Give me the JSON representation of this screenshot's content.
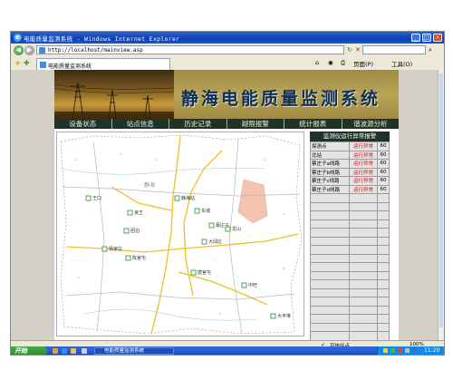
{
  "window": {
    "title": "电能质量监测系统 - Windows Internet Explorer"
  },
  "browser": {
    "address": "http://localhost/mainview.asp",
    "search_placeholder": "",
    "tab_title": "电能质量监测系统",
    "page_menu": "页面(P)",
    "tools_menu": "工具(O)"
  },
  "app": {
    "title": "静海电能质量监测系统",
    "menu": [
      "设备状态",
      "站点信息",
      "历史记录",
      "越限报警",
      "统计报表",
      "谐波源分析"
    ],
    "panel": {
      "header": "监测仪运行异常报警",
      "rows": [
        {
          "name": "探测点",
          "status": "运行异常",
          "count": "60"
        },
        {
          "name": "北站",
          "status": "运行异常",
          "count": "60"
        },
        {
          "name": "蔡庄子a线路",
          "status": "运行异常",
          "count": "60"
        },
        {
          "name": "蔡庄子b线路",
          "status": "运行异常",
          "count": "60"
        },
        {
          "name": "蔡庄子c线路",
          "status": "运行异常",
          "count": "60"
        },
        {
          "name": "蔡庄子d线路",
          "status": "运行异常",
          "count": "60"
        }
      ],
      "empty_rows": 20
    },
    "map": {
      "stations": [
        {
          "label": "静海站"
        },
        {
          "label": "东城"
        },
        {
          "label": "蔡庄子"
        },
        {
          "label": "龙山"
        },
        {
          "label": "大邱庄"
        },
        {
          "label": "良王"
        },
        {
          "label": "王口"
        },
        {
          "label": "团泊"
        },
        {
          "label": "杨家庄"
        },
        {
          "label": "陈官屯"
        },
        {
          "label": "唐官屯"
        },
        {
          "label": "中旺"
        },
        {
          "label": "大丰堆"
        }
      ],
      "city_label": "静海"
    }
  },
  "statusbar": {
    "zone": "可信站点",
    "zoom": "100%"
  },
  "taskbar": {
    "start": "开始",
    "task": "电能质量监测系统",
    "clock": "11:20"
  },
  "colors": {
    "menu_bg": "#1f3328",
    "alert_text": "#d01010",
    "title_text": "#0d2d5c"
  }
}
